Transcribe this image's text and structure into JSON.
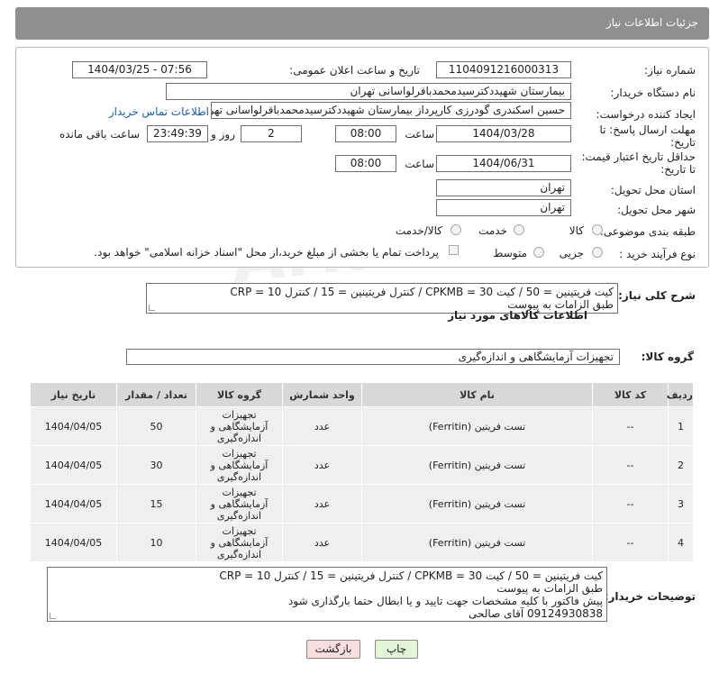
{
  "header": {
    "title": "جزئیات اطلاعات نیاز"
  },
  "form": {
    "need_number_label": "شماره نیاز:",
    "need_number": "1104091216000313",
    "announce_label": "تاریخ و ساعت اعلان عمومی:",
    "announce_value": "1404/03/25 - 07:56",
    "buyer_org_label": "نام دستگاه خریدار:",
    "buyer_org": "بیمارستان شهیددکترسیدمحمدباقرلواسانی تهران",
    "creator_label": "ایجاد کننده درخواست:",
    "creator": "حسین اسکندری گودرزی کارپرداز بیمارستان شهیددکترسیدمحمدباقرلواسانی تهران",
    "contact_link": "اطلاعات تماس خریدار",
    "reply_deadline_label": "مهلت ارسال پاسخ: تا تاریخ:",
    "reply_date": "1404/03/28",
    "time_label": "ساعت",
    "reply_time": "08:00",
    "days_count": "2",
    "days_label": "روز و",
    "remaining_time": "23:49:39",
    "remaining_label": "ساعت باقی مانده",
    "price_deadline_label": "حداقل تاریخ اعتبار قیمت: تا تاریخ:",
    "price_date": "1404/06/31",
    "price_time": "08:00",
    "province_label": "استان محل تحویل:",
    "province": "تهران",
    "city_label": "شهر محل تحویل:",
    "city": "تهران",
    "category_label": "طبقه بندی موضوعی:",
    "category_options": [
      "کالا",
      "خدمت",
      "کالا/خدمت"
    ],
    "process_label": "نوع فرآیند خرید :",
    "process_options": [
      "جزیی",
      "متوسط"
    ],
    "payment_note": "پرداخت تمام یا بخشی از مبلغ خرید،از محل \"اسناد خزانه اسلامی\" خواهد بود."
  },
  "general_desc": {
    "label": "شرح کلی نیاز:",
    "line1": "کیت فریتینین = 50 / کیت CPKMB = 30 / کنترل فریتینین = 15 / کنترل CRP = 10",
    "line2": "طبق الزامات به پیوست"
  },
  "goods": {
    "section_title": "اطلاعات کالاهای مورد نیاز",
    "group_label": "گروه کالا:",
    "group_value": "تجهیزات آزمایشگاهی و اندازه‌گیری",
    "columns": [
      "ردیف",
      "کد کالا",
      "نام کالا",
      "واحد شمارش",
      "گروه کالا",
      "تعداد / مقدار",
      "تاریخ نیاز"
    ],
    "rows": [
      {
        "row": "1",
        "code": "--",
        "name": "تست فریتین (Ferritin)",
        "unit": "عدد",
        "group": "تجهیزات آزمایشگاهی و اندازه‌گیری",
        "qty": "50",
        "date": "1404/04/05"
      },
      {
        "row": "2",
        "code": "--",
        "name": "تست فریتین (Ferritin)",
        "unit": "عدد",
        "group": "تجهیزات آزمایشگاهی و اندازه‌گیری",
        "qty": "30",
        "date": "1404/04/05"
      },
      {
        "row": "3",
        "code": "--",
        "name": "تست فریتین (Ferritin)",
        "unit": "عدد",
        "group": "تجهیزات آزمایشگاهی و اندازه‌گیری",
        "qty": "15",
        "date": "1404/04/05"
      },
      {
        "row": "4",
        "code": "--",
        "name": "تست فریتین (Ferritin)",
        "unit": "عدد",
        "group": "تجهیزات آزمایشگاهی و اندازه‌گیری",
        "qty": "10",
        "date": "1404/04/05"
      }
    ]
  },
  "buyer_notes": {
    "label": "توضیحات خریدار:",
    "line1": "کیت فریتینین = 50 / کیت CPKMB = 30 / کنترل فریتینین = 15 / کنترل CRP = 10",
    "line2": "طبق الزامات به پیوست",
    "line3": "پیش فاکتور با کلیه مشخصات جهت تایید و یا ابطال حتما بارگذاری شود",
    "line4": "09124930838 آقای صالحی"
  },
  "actions": {
    "print": "چاپ",
    "back": "بازگشت"
  },
  "watermark": {
    "text": "AriaTender.net"
  },
  "colors": {
    "header_bg": "#8f8f8f",
    "print_btn": "#e2f5d8",
    "back_btn": "#f9dede",
    "link": "#1e5aa8"
  }
}
